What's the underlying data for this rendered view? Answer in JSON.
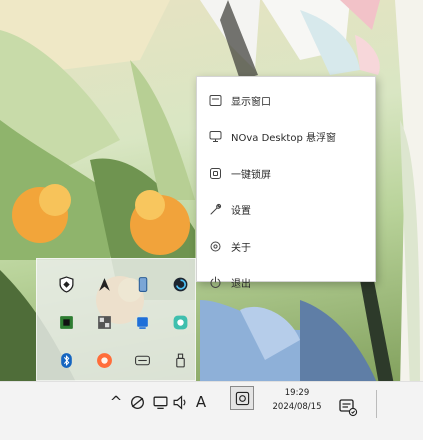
{
  "context_menu": {
    "items": [
      {
        "label": "显示窗口",
        "icon": "window-icon"
      },
      {
        "label": "NOva Desktop 悬浮窗",
        "icon": "monitor-icon"
      },
      {
        "label": "一键锁屏",
        "icon": "lock-screen-icon"
      },
      {
        "label": "设置",
        "icon": "wrench-icon"
      },
      {
        "label": "关于",
        "icon": "gear-icon"
      },
      {
        "label": "退出",
        "icon": "power-icon"
      }
    ]
  },
  "tray_flyout": {
    "icons": [
      "shield-app-icon",
      "rocket-app-icon",
      "phone-app-icon",
      "spiral-app-icon",
      "green-app-icon",
      "grid-app-icon",
      "blue-square-app-icon",
      "teal-circle-app-icon",
      "bluetooth-icon",
      "orange-circle-app-icon",
      "keyboard-icon",
      "usb-icon"
    ]
  },
  "taskbar": {
    "chevron": "^",
    "ime": "A",
    "time": "19:29",
    "date": "2024/08/15"
  },
  "colors": {
    "menu_bg": "#ffffff",
    "taskbar_bg": "#f3f3f3",
    "menu_text": "#2a2a2a"
  }
}
